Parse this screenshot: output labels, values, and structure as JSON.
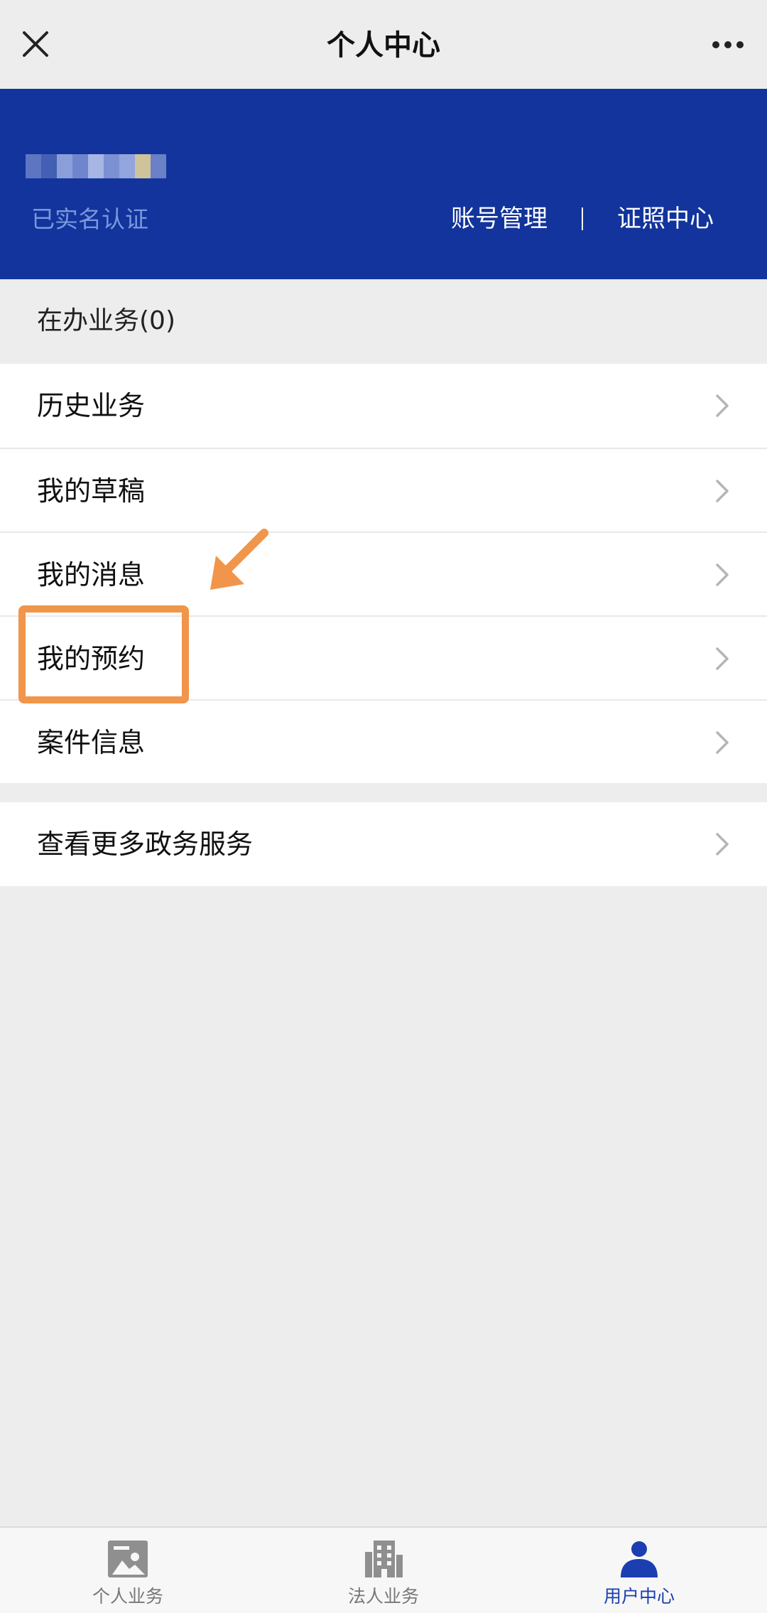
{
  "navbar": {
    "title": "个人中心",
    "close_icon": "close-icon",
    "more_icon": "more-icon"
  },
  "profile": {
    "verified_label": "已实名认证",
    "links": [
      "账号管理",
      "证照中心"
    ],
    "background_color": "#12349c"
  },
  "section_header": "在办业务(0)",
  "group1": {
    "items": [
      {
        "label": "历史业务"
      },
      {
        "label": "我的草稿"
      },
      {
        "label": "我的消息"
      },
      {
        "label": "我的预约"
      },
      {
        "label": "案件信息"
      }
    ]
  },
  "group2": {
    "items": [
      {
        "label": "查看更多政务服务"
      }
    ]
  },
  "annotation": {
    "highlight_color": "#f0954a",
    "highlighted_item": "我的预约"
  },
  "tabbar": {
    "tabs": [
      {
        "label": "个人业务",
        "icon": "id-card-icon",
        "active": false
      },
      {
        "label": "法人业务",
        "icon": "building-icon",
        "active": false
      },
      {
        "label": "用户中心",
        "icon": "user-icon",
        "active": true
      }
    ],
    "active_color": "#1b3fb0"
  }
}
